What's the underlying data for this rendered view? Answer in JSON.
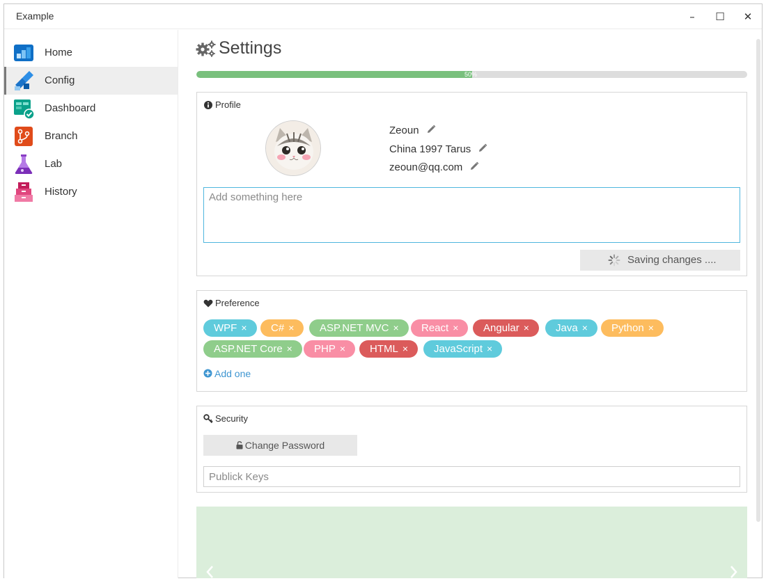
{
  "window": {
    "title": "Example",
    "controls": {
      "minimize": "–",
      "maximize": "☐",
      "close": "✕"
    }
  },
  "sidebar": {
    "items": [
      {
        "label": "Home",
        "icon": "home-icon",
        "active": false
      },
      {
        "label": "Config",
        "icon": "config-icon",
        "active": true
      },
      {
        "label": "Dashboard",
        "icon": "dashboard-icon",
        "active": false
      },
      {
        "label": "Branch",
        "icon": "branch-icon",
        "active": false
      },
      {
        "label": "Lab",
        "icon": "lab-flask-icon",
        "active": false
      },
      {
        "label": "History",
        "icon": "history-icon",
        "active": false
      }
    ]
  },
  "page": {
    "title": "Settings",
    "icon": "gears-icon"
  },
  "progress": {
    "value": 0.5,
    "label": "50%",
    "color": "#79c07d"
  },
  "profile": {
    "heading": "Profile",
    "heading_icon": "info-circle-icon",
    "avatar_icon": "cat-avatar",
    "name": "Zeoun",
    "location": "China 1997 Tarus",
    "email": "zeoun@qq.com",
    "note_placeholder": "Add something here",
    "save_button_label": "Saving changes ...."
  },
  "preference": {
    "heading": "Preference",
    "heading_icon": "heart-icon",
    "remove_glyph": "×",
    "tags": [
      {
        "label": "WPF",
        "color": "#5fcbdc"
      },
      {
        "label": "C#",
        "color": "#fdbc5e"
      },
      {
        "label": "ASP.NET MVC",
        "color": "#8fcd8b"
      },
      {
        "label": "React",
        "color": "#f98ea5"
      },
      {
        "label": "Angular",
        "color": "#db5b5b"
      },
      {
        "label": "Java",
        "color": "#5fcbdc"
      },
      {
        "label": "Python",
        "color": "#fdbc5e"
      },
      {
        "label": "ASP.NET Core",
        "color": "#8fcd8b"
      },
      {
        "label": "PHP",
        "color": "#f98ea5"
      },
      {
        "label": "HTML",
        "color": "#db5b5b"
      },
      {
        "label": "JavaScript",
        "color": "#5fcbdc"
      }
    ],
    "add_label": "Add one"
  },
  "security": {
    "heading": "Security",
    "heading_icon": "key-icon",
    "change_password_label": "Change Password",
    "keys_placeholder": "Publick Keys"
  },
  "carousel": {
    "background": "#dbeedb",
    "prev_icon": "chevron-left-icon",
    "next_icon": "chevron-right-icon"
  }
}
